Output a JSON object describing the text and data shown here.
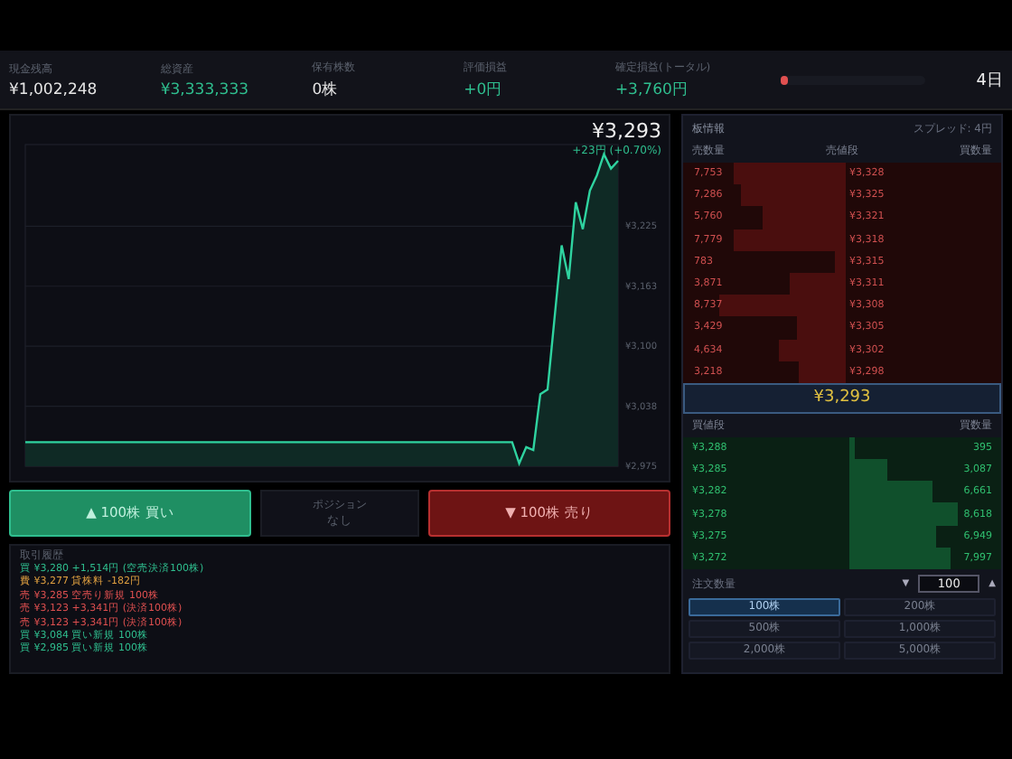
{
  "stats": [
    {
      "label": "現金残高",
      "value": "¥1,002,248",
      "positive": false
    },
    {
      "label": "総資産",
      "value": "¥3,333,333",
      "positive": true
    },
    {
      "label": "保有株数",
      "value": "0株",
      "positive": false
    },
    {
      "label": "評価損益",
      "value": "+0円",
      "positive": true
    },
    {
      "label": "確定損益(トータル)",
      "value": "+3,760円",
      "positive": true
    }
  ],
  "progress": {
    "level": 0.05,
    "label": "4日"
  },
  "chart": {
    "price": "¥3,293",
    "change": "+23円 (+0.70%)",
    "chart_data": {
      "type": "area",
      "categories": [
        null,
        null,
        null,
        null,
        null,
        null,
        null,
        null,
        null,
        null,
        null,
        null,
        null,
        null,
        null,
        null,
        null,
        null,
        null,
        null,
        null,
        null,
        null,
        null,
        null,
        null,
        null,
        null,
        null,
        null,
        null,
        null,
        null,
        null,
        null,
        null,
        null,
        null,
        null,
        null,
        null,
        null,
        null,
        null,
        null,
        null,
        null,
        null,
        null,
        null,
        null,
        null,
        null,
        null,
        null,
        null,
        null,
        null,
        null,
        null,
        null,
        null,
        null,
        null,
        null,
        null,
        null,
        null,
        null,
        null,
        null,
        null,
        null,
        null,
        null,
        null,
        null,
        null,
        null,
        null,
        null,
        null,
        null,
        null,
        null
      ],
      "grid": true,
      "ylim": [
        2975,
        3310
      ],
      "yticks": [
        {
          "value": 3225,
          "label": "¥3,225"
        },
        {
          "value": 3162.5,
          "label": "¥3,163"
        },
        {
          "value": 3100,
          "label": "¥3,100"
        },
        {
          "value": 3037.5,
          "label": "¥3,038"
        },
        {
          "value": 2975,
          "label": "¥2,975"
        }
      ],
      "series": [
        {
          "color": "#2fd3a0",
          "values": [
            3000,
            3000,
            3000,
            3000,
            3000,
            3000,
            3000,
            3000,
            3000,
            3000,
            3000,
            3000,
            3000,
            3000,
            3000,
            3000,
            3000,
            3000,
            3000,
            3000,
            3000,
            3000,
            3000,
            3000,
            3000,
            3000,
            3000,
            3000,
            3000,
            3000,
            3000,
            3000,
            3000,
            3000,
            3000,
            3000,
            3000,
            3000,
            3000,
            3000,
            3000,
            3000,
            3000,
            3000,
            3000,
            3000,
            3000,
            3000,
            3000,
            3000,
            3000,
            3000,
            3000,
            3000,
            3000,
            3000,
            3000,
            3000,
            3000,
            3000,
            3000,
            3000,
            3000,
            3000,
            3000,
            3000,
            3000,
            3000,
            3000,
            3000,
            2978,
            2995,
            2992,
            3050,
            3055,
            3130,
            3205,
            3170,
            3250,
            3222,
            3262,
            3278,
            3300,
            3285,
            3293
          ]
        }
      ]
    }
  },
  "actions": {
    "buy": "▲ 100株 買い",
    "position_label": "ポジション",
    "position_value": "なし",
    "sell": "▼ 100株 売り"
  },
  "log": {
    "title": "取引履歴",
    "entries": [
      {
        "kind": "buy",
        "text": "買 ¥3,280 +1,514円 (空売決済100株)"
      },
      {
        "kind": "fee",
        "text": "費 ¥3,277 貸株料 -182円"
      },
      {
        "kind": "sell",
        "text": "売 ¥3,285 空売り新規 100株"
      },
      {
        "kind": "sell",
        "text": "売 ¥3,123 +3,341円 (決済100株)"
      },
      {
        "kind": "sell",
        "text": "売 ¥3,123 +3,341円 (決済100株)"
      },
      {
        "kind": "buy",
        "text": "買 ¥3,084 買い新規 100株"
      },
      {
        "kind": "buy",
        "text": "買 ¥2,985 買い新規 100株"
      }
    ]
  },
  "book": {
    "title": "板情報",
    "spread": "スプレッド: 4円",
    "ask_headers": [
      "売数量",
      "売値段",
      "買数量"
    ],
    "asks": [
      {
        "qty": "7,753",
        "price": "¥3,328"
      },
      {
        "qty": "7,286",
        "price": "¥3,325"
      },
      {
        "qty": "5,760",
        "price": "¥3,321"
      },
      {
        "qty": "7,779",
        "price": "¥3,318"
      },
      {
        "qty": "783",
        "price": "¥3,315"
      },
      {
        "qty": "3,871",
        "price": "¥3,311"
      },
      {
        "qty": "8,737",
        "price": "¥3,308"
      },
      {
        "qty": "3,429",
        "price": "¥3,305"
      },
      {
        "qty": "4,634",
        "price": "¥3,302"
      },
      {
        "qty": "3,218",
        "price": "¥3,298"
      }
    ],
    "mid": "¥3,293",
    "bid_headers": [
      "買値段",
      "買数量"
    ],
    "bids": [
      {
        "price": "¥3,288",
        "qty": "395"
      },
      {
        "price": "¥3,285",
        "qty": "3,087"
      },
      {
        "price": "¥3,282",
        "qty": "6,661"
      },
      {
        "price": "¥3,278",
        "qty": "8,618"
      },
      {
        "price": "¥3,275",
        "qty": "6,949"
      },
      {
        "price": "¥3,272",
        "qty": "7,997"
      }
    ]
  },
  "order": {
    "label": "注文数量",
    "minus": "▼",
    "value": "100",
    "plus": "▲",
    "presets": [
      {
        "label": "100株",
        "selected": true
      },
      {
        "label": "200株",
        "selected": false
      },
      {
        "label": "500株",
        "selected": false
      },
      {
        "label": "1,000株",
        "selected": false
      },
      {
        "label": "2,000株",
        "selected": false
      },
      {
        "label": "5,000株",
        "selected": false
      }
    ]
  }
}
